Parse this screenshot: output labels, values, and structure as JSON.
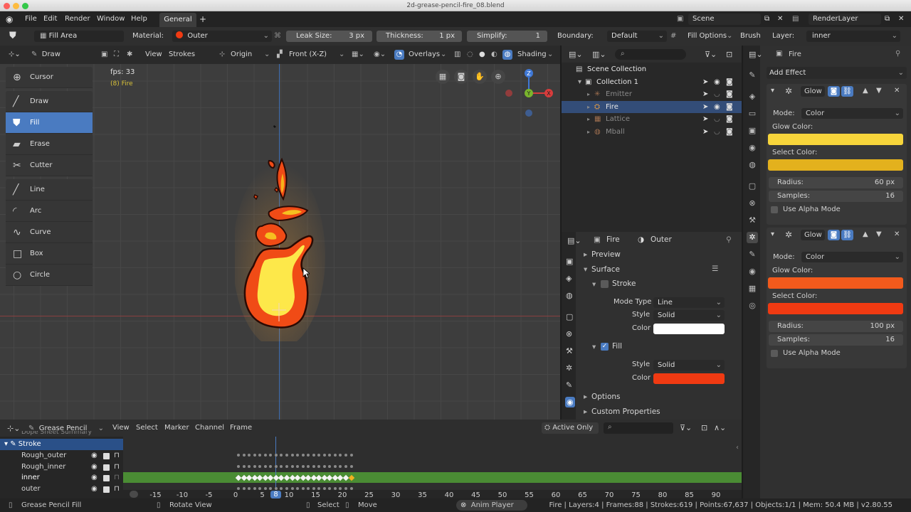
{
  "window": {
    "title": "2d-grease-pencil-fire_08.blend"
  },
  "menu": {
    "items": [
      "File",
      "Edit",
      "Render",
      "Window",
      "Help"
    ],
    "workspace_tab": "General",
    "add_tab": "+",
    "scene_label": "Scene",
    "render_layer": "RenderLayer"
  },
  "tool_settings": {
    "mode": "Fill Area",
    "material_label": "Material:",
    "material_value": "Outer",
    "leak_label": "Leak Size:",
    "leak_value": "3 px",
    "thickness_label": "Thickness:",
    "thickness_value": "1 px",
    "simplify_label": "Simplify:",
    "simplify_value": "1",
    "boundary_label": "Boundary:",
    "boundary_value": "Default",
    "fill_options": "Fill Options",
    "brush_label": "Brush",
    "layer_label": "Layer:",
    "layer_value": "inner"
  },
  "viewport_header": {
    "mode": "Draw",
    "view": "View",
    "strokes": "Strokes",
    "origin": "Origin",
    "projection": "Front (X-Z)",
    "overlays": "Overlays",
    "shading": "Shading"
  },
  "viewport": {
    "fps": "fps: 33",
    "object_info": "(8) Fire"
  },
  "toolbar": {
    "groups": [
      [
        {
          "label": "Cursor",
          "icon": "cursor-icon"
        }
      ],
      [
        {
          "label": "Draw",
          "icon": "draw-icon"
        },
        {
          "label": "Fill",
          "icon": "fill-icon",
          "active": true
        },
        {
          "label": "Erase",
          "icon": "erase-icon"
        },
        {
          "label": "Cutter",
          "icon": "cutter-icon"
        }
      ],
      [
        {
          "label": "Line",
          "icon": "line-icon"
        },
        {
          "label": "Arc",
          "icon": "arc-icon"
        },
        {
          "label": "Curve",
          "icon": "curve-icon"
        },
        {
          "label": "Box",
          "icon": "box-icon"
        },
        {
          "label": "Circle",
          "icon": "circle-icon"
        }
      ]
    ]
  },
  "outliner": {
    "rows": [
      {
        "label": "Scene Collection",
        "indent": 0
      },
      {
        "label": "Collection 1",
        "indent": 1
      },
      {
        "label": "Emitter",
        "indent": 2,
        "dim": true
      },
      {
        "label": "Fire",
        "indent": 2,
        "selected": true
      },
      {
        "label": "Lattice",
        "indent": 2,
        "dim": true
      },
      {
        "label": "Mball",
        "indent": 2,
        "dim": true
      }
    ]
  },
  "properties": {
    "object": "Fire",
    "material": "Outer",
    "sections": {
      "preview": "Preview",
      "surface": "Surface",
      "stroke": "Stroke",
      "mode_type_label": "Mode Type",
      "mode_type_value": "Line",
      "style_label": "Style",
      "style_value": "Solid",
      "color_label": "Color",
      "fill": "Fill",
      "fill_style_value": "Solid",
      "options": "Options",
      "custom": "Custom Properties"
    },
    "stroke_color": "#ffffff",
    "fill_color": "#f03a12"
  },
  "effects": {
    "object": "Fire",
    "add_effect": "Add Effect",
    "items": [
      {
        "name": "Glow",
        "mode_label": "Mode:",
        "mode_value": "Color",
        "glow_color_label": "Glow Color:",
        "glow_color": "#f7d53b",
        "select_color_label": "Select Color:",
        "select_color": "#e3b11d",
        "radius_label": "Radius:",
        "radius_value": "60 px",
        "samples_label": "Samples:",
        "samples_value": "16",
        "alpha_label": "Use Alpha Mode"
      },
      {
        "name": "Glow",
        "mode_label": "Mode:",
        "mode_value": "Color",
        "glow_color_label": "Glow Color:",
        "glow_color": "#f25a1c",
        "select_color_label": "Select Color:",
        "select_color": "#f03a12",
        "radius_label": "Radius:",
        "radius_value": "100 px",
        "samples_label": "Samples:",
        "samples_value": "16",
        "alpha_label": "Use Alpha Mode"
      }
    ]
  },
  "dopesheet": {
    "mode": "Grease Pencil",
    "menus": [
      "View",
      "Select",
      "Marker",
      "Channel",
      "Frame"
    ],
    "active_only": "Active Only",
    "summary": "Dope Sheet Summary",
    "object": "Stroke",
    "channels": [
      "Rough_outer",
      "Rough_inner",
      "inner",
      "outer"
    ],
    "current_frame": "8",
    "frames": [
      "-15",
      "-10",
      "-5",
      "0",
      "5",
      "10",
      "15",
      "20",
      "25",
      "30",
      "35",
      "40",
      "45",
      "50",
      "55",
      "60",
      "65",
      "70",
      "75",
      "80",
      "85",
      "90"
    ]
  },
  "status": {
    "left": "Grease Pencil Fill",
    "rotate": "Rotate View",
    "select": "Select",
    "move": "Move",
    "anim": "Anim Player",
    "info": "Fire | Layers:4 | Frames:88 | Strokes:619 | Points:67,637 | Objects:1/1 | Mem: 50.4 MB | v2.80.55"
  }
}
